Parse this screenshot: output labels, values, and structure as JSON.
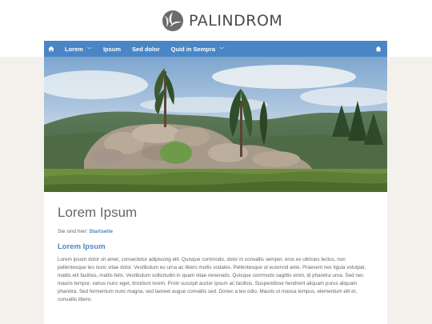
{
  "brand": {
    "name": "PALINDROM"
  },
  "nav": {
    "items": [
      {
        "label": "Lorem",
        "has_caret": true
      },
      {
        "label": "Ipsum",
        "has_caret": false
      },
      {
        "label": "Sed dolor",
        "has_caret": false
      },
      {
        "label": "Quid in Sempra",
        "has_caret": true
      }
    ],
    "home_icon": "home-icon",
    "search_icon": "search-icon"
  },
  "colors": {
    "accent": "#4a86c5",
    "page_bg": "#f4f1ec"
  },
  "main": {
    "title": "Lorem Ipsum",
    "breadcrumb_prefix": "Sie sind hier:",
    "breadcrumb_link": "Startseite",
    "subtitle": "Lorem Ipsum",
    "body": "Lorem ipsum dolor sit amet, consectetur adipiscing elit. Quisque commodo, dolor in convallis semper, eros ex ultricies lectus, non pellentesque leo nunc vitae dolor. Vestibulum eu urna ac libero mollis sodales. Pellentesque ut euismod ante. Praesent nec ligula volutpat, mattis elit facilisis, mattis felis. Vestibulum sollicitudin in quam vitae venenatis. Quisque commodo sagittis enim, id pharetra urna. Sed nec mauris tempor, varius nunc eget, tincidunt lorem. Proin suscipit auctor ipsum ac facilisis. Suspendisse hendrerit aliquam purus aliquam pharetra. Sed fermentum nunc magna, sed laoreet augue convallis sed. Donec a leo odio. Mauris ut massa tempus, elementum elit et, convallis libero."
  }
}
